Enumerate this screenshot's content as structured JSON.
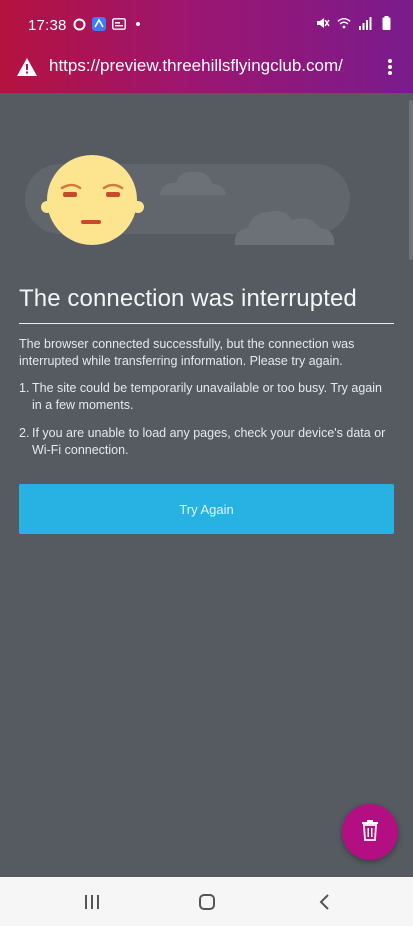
{
  "status_bar": {
    "time": "17:38",
    "left_icons": [
      "sync-icon",
      "app-icon",
      "card-icon",
      "dot-icon"
    ],
    "right_icons": [
      "mute-icon",
      "wifi-icon",
      "signal-icon",
      "battery-icon"
    ]
  },
  "url_bar": {
    "url": "https://preview.threehillsflyingclub.com/",
    "security_icon": "warning-icon",
    "menu_icon": "kebab-menu-icon"
  },
  "error_page": {
    "title": "The connection was interrupted",
    "description": "The browser connected successfully, but the connection was interrupted while transferring information. Please try again.",
    "tips": [
      {
        "num": "1.",
        "text": "The site could be temporarily unavailable or too busy. Try again in a few moments."
      },
      {
        "num": "2.",
        "text": "If you are unable to load any pages, check your device's data or Wi-Fi connection."
      }
    ],
    "retry_button": "Try Again"
  },
  "fab": {
    "icon": "trash-icon"
  },
  "nav_bar": {
    "icons": [
      "recent-apps-icon",
      "home-icon",
      "back-icon"
    ]
  },
  "colors": {
    "chrome_gradient_start": "#b5123f",
    "chrome_gradient_end": "#7a1b8d",
    "page_background": "#555b61",
    "button": "#27b2e3",
    "fab": "#b30f82"
  }
}
